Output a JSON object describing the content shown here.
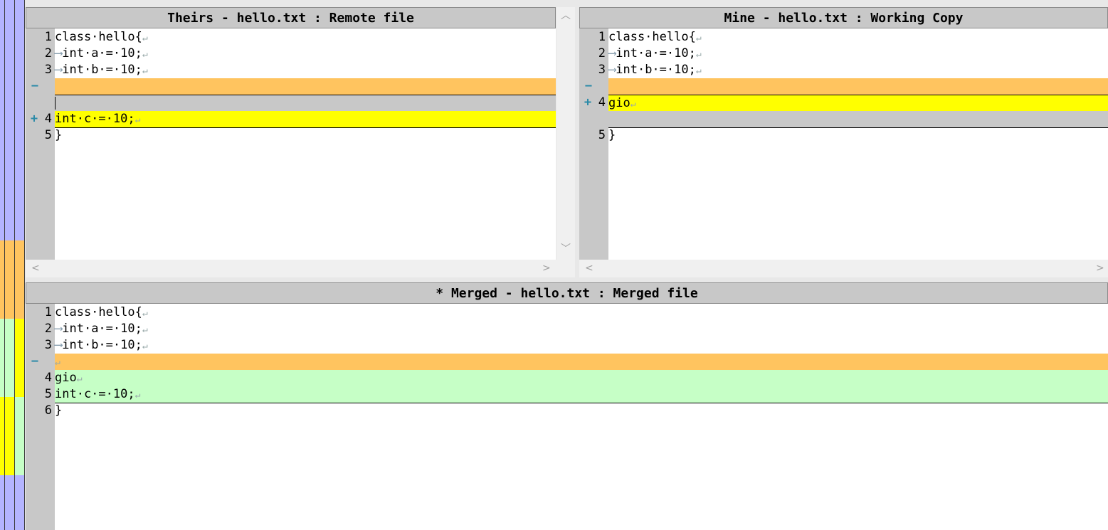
{
  "colors": {
    "removed": "#ffc45f",
    "changed": "#ffff00",
    "merged": "#c6ffc6",
    "gutter": "#c8c8c8",
    "locbar_blue": "#b4b4ff"
  },
  "theirs": {
    "title": "Theirs - hello.txt : Remote file",
    "lines": [
      {
        "num": "1",
        "text": "class·hello{"
      },
      {
        "num": "2",
        "text": "int·a·=·10;"
      },
      {
        "num": "3",
        "text": "int·b·=·10;"
      },
      {
        "mark": "−"
      },
      {
        "num": "4",
        "mark": "+",
        "text": "int·c·=·10;"
      },
      {
        "num": "5",
        "text": "}"
      }
    ]
  },
  "mine": {
    "title": "Mine - hello.txt : Working Copy",
    "lines": [
      {
        "num": "1",
        "text": "class·hello{"
      },
      {
        "num": "2",
        "text": "int·a·=·10;"
      },
      {
        "num": "3",
        "text": "int·b·=·10;"
      },
      {
        "mark": "−"
      },
      {
        "num": "4",
        "mark": "+",
        "text": "gio"
      },
      {
        "num": "5",
        "text": "}"
      }
    ]
  },
  "merged": {
    "title": "* Merged - hello.txt : Merged file",
    "lines": [
      {
        "num": "1",
        "text": "class·hello{"
      },
      {
        "num": "2",
        "text": "int·a·=·10;"
      },
      {
        "num": "3",
        "text": "int·b·=·10;"
      },
      {
        "mark": "−"
      },
      {
        "num": "4",
        "text": "gio"
      },
      {
        "num": "5",
        "text": "int·c·=·10;"
      },
      {
        "num": "6",
        "text": "}"
      }
    ]
  },
  "glyphs": {
    "tab": "⟶",
    "eol": "↵",
    "scroll_left": "<",
    "scroll_right": ">",
    "scroll_up": "︿",
    "scroll_down": "﹀"
  }
}
